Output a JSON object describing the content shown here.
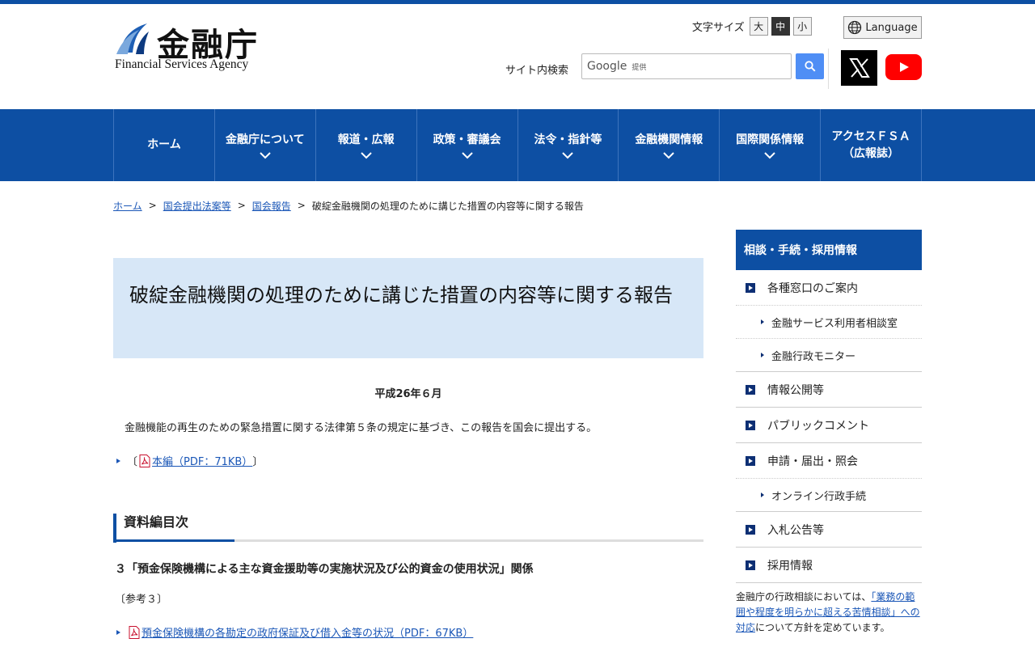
{
  "header": {
    "logo_jp": "金融庁",
    "logo_en": "Financial Services Agency",
    "font_size_label": "文字サイズ",
    "font_sizes": [
      "大",
      "中",
      "小"
    ],
    "language": "Language",
    "search_label": "サイト内検索",
    "search_google": "Google",
    "search_provided": "提供"
  },
  "nav": {
    "items": [
      {
        "label": "ホーム"
      },
      {
        "label": "金融庁について"
      },
      {
        "label": "報道・広報"
      },
      {
        "label": "政策・審議会"
      },
      {
        "label": "法令・指針等"
      },
      {
        "label": "金融機関情報"
      },
      {
        "label": "国際関係情報"
      },
      {
        "label": "アクセスＦＳＡ\n（広報誌）"
      }
    ]
  },
  "breadcrumb": {
    "items": [
      "ホーム",
      "国会提出法案等",
      "国会報告"
    ],
    "current": "破綻金融機関の処理のために講じた措置の内容等に関する報告",
    "sep": ">"
  },
  "main": {
    "title": "破綻金融機関の処理のために講じた措置の内容等に関する報告",
    "date": "平成26年６月",
    "paragraph": "金融機能の再生のための緊急措置に関する法律第５条の規定に基づき、この報告を国会に提出する。",
    "link1_open": "〔",
    "link1_text": "本編（PDF：71KB）",
    "link1_close": "〕",
    "section_heading": "資料編目次",
    "sub_heading": "３「預金保険機構による主な資金援助等の実施状況及び公的資金の使用状況」関係",
    "ref_label": "〔参考３〕",
    "link2_text": "預金保険機構の各勘定の政府保証及び借入金等の状況（PDF：67KB）"
  },
  "side": {
    "heading": "相談・手続・採用情報",
    "item1": "各種窓口のご案内",
    "sub1a": "金融サービス利用者相談室",
    "sub1b": "金融行政モニター",
    "item2": "情報公開等",
    "item3": "パブリックコメント",
    "item4": "申請・届出・照会",
    "sub4a": "オンライン行政手続",
    "item5": "入札公告等",
    "item6": "採用情報",
    "note_pre": "金融庁の行政相談においては、",
    "note_link": "「業務の範囲や程度を明らかに超える苦情相談」への対応",
    "note_post": "について方針を定めています。"
  },
  "colors": {
    "primary": "#0d4fa3",
    "title_bg": "#d7e7f7",
    "link": "#1b57b7",
    "search_btn": "#4f8ef5",
    "youtube": "#ff0000"
  }
}
